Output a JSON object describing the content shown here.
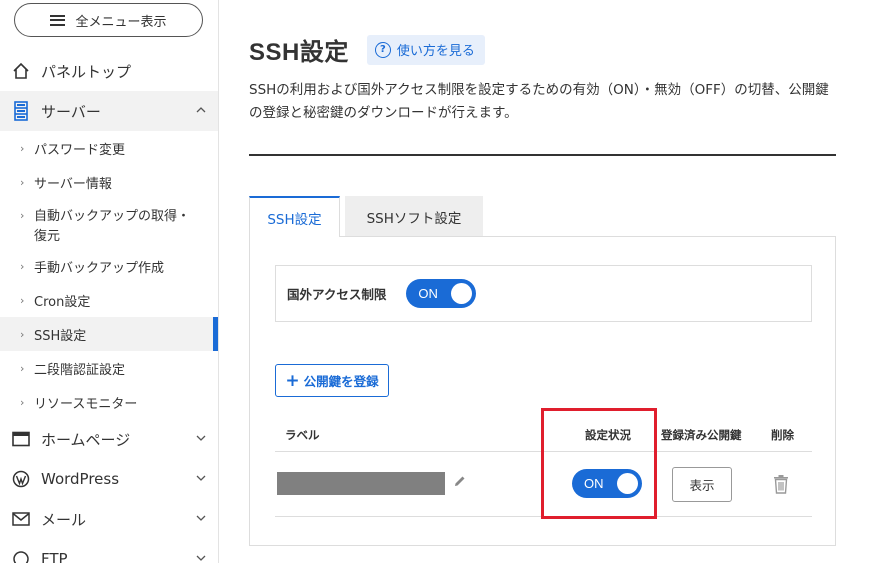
{
  "sidebar": {
    "menu_button_label": "全メニュー表示",
    "items": [
      {
        "label": "パネルトップ",
        "icon": "home-icon"
      },
      {
        "label": "サーバー",
        "icon": "server-icon",
        "expanded": true
      },
      {
        "label": "ホームページ",
        "icon": "browser-window-icon"
      },
      {
        "label": "WordPress",
        "icon": "wordpress-icon"
      },
      {
        "label": "メール",
        "icon": "mail-icon"
      },
      {
        "label": "FTP",
        "icon": "ftp-icon"
      }
    ],
    "server_subitems": [
      {
        "label": "パスワード変更"
      },
      {
        "label": "サーバー情報"
      },
      {
        "label": "自動バックアップの取得・復元"
      },
      {
        "label": "手動バックアップ作成"
      },
      {
        "label": "Cron設定"
      },
      {
        "label": "SSH設定",
        "selected": true
      },
      {
        "label": "二段階認証設定"
      },
      {
        "label": "リソースモニター"
      }
    ]
  },
  "main": {
    "title": "SSH設定",
    "help_label": "使い方を見る",
    "description": "SSHの利用および国外アクセス制限を設定するための有効（ON）・無効（OFF）の切替、公開鍵の登録と秘密鍵のダウンロードが行えます。",
    "tabs": [
      {
        "label": "SSH設定",
        "active": true
      },
      {
        "label": "SSHソフト設定",
        "active": false
      }
    ],
    "foreign_access": {
      "label": "国外アクセス制限",
      "toggle": "ON"
    },
    "add_key_label": "公開鍵を登録",
    "table": {
      "headers": {
        "label": "ラベル",
        "status": "設定状況",
        "registered": "登録済み公開鍵",
        "delete": "削除"
      },
      "rows": [
        {
          "status": "ON",
          "show_label": "表示"
        }
      ]
    }
  },
  "colors": {
    "accent": "#1a6bd6",
    "highlight": "#e01e2d",
    "redacted": "#808080"
  }
}
